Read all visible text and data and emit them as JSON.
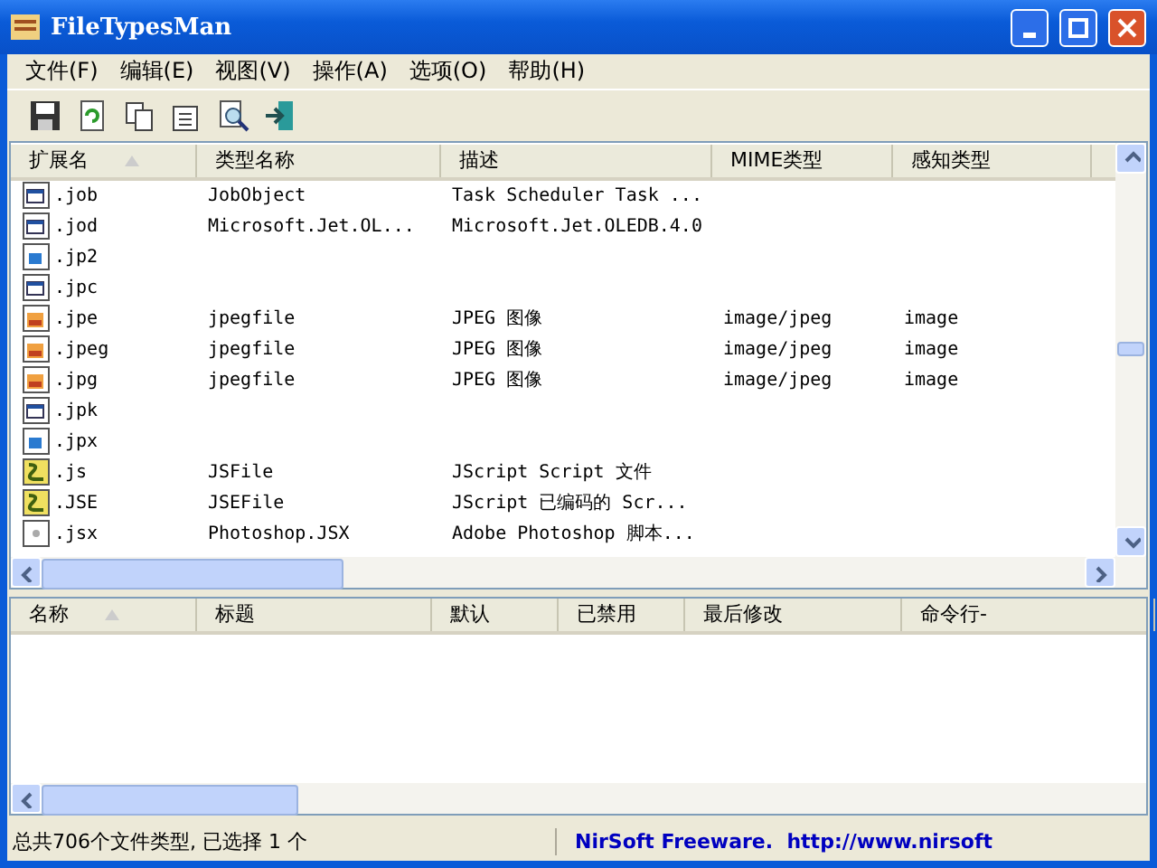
{
  "window": {
    "title": "FileTypesMan"
  },
  "menu": [
    "文件(F)",
    "编辑(E)",
    "视图(V)",
    "操作(A)",
    "选项(O)",
    "帮助(H)"
  ],
  "toolbar": [
    {
      "kind": "save"
    },
    {
      "kind": "refresh"
    },
    {
      "kind": "copy"
    },
    {
      "kind": "properties"
    },
    {
      "kind": "find"
    },
    {
      "kind": "exit"
    }
  ],
  "top_table": {
    "columns": [
      {
        "label": "扩展名",
        "sorted": true
      },
      {
        "label": "类型名称",
        "sorted": false
      },
      {
        "label": "描述",
        "sorted": false
      },
      {
        "label": "MIME类型",
        "sorted": false
      },
      {
        "label": "感知类型",
        "sorted": false
      }
    ],
    "rows": [
      {
        "kind": "window",
        "cells": [
          ".job",
          "JobObject",
          "Task Scheduler Task ...",
          "",
          ""
        ]
      },
      {
        "kind": "window",
        "cells": [
          ".jod",
          "Microsoft.Jet.OL...",
          "Microsoft.Jet.OLEDB.4.0",
          "",
          ""
        ]
      },
      {
        "kind": "image",
        "cells": [
          ".jp2",
          "",
          "",
          "",
          ""
        ]
      },
      {
        "kind": "window",
        "cells": [
          ".jpc",
          "",
          "",
          "",
          ""
        ]
      },
      {
        "kind": "jpeg",
        "cells": [
          ".jpe",
          "jpegfile",
          "JPEG 图像",
          "image/jpeg",
          "image"
        ]
      },
      {
        "kind": "jpeg",
        "cells": [
          ".jpeg",
          "jpegfile",
          "JPEG 图像",
          "image/jpeg",
          "image"
        ]
      },
      {
        "kind": "jpeg",
        "cells": [
          ".jpg",
          "jpegfile",
          "JPEG 图像",
          "image/jpeg",
          "image"
        ]
      },
      {
        "kind": "window",
        "cells": [
          ".jpk",
          "",
          "",
          "",
          ""
        ]
      },
      {
        "kind": "image",
        "cells": [
          ".jpx",
          "",
          "",
          "",
          ""
        ]
      },
      {
        "kind": "script",
        "cells": [
          ".js",
          "JSFile",
          "JScript Script 文件",
          "",
          ""
        ]
      },
      {
        "kind": "script",
        "cells": [
          ".JSE",
          "JSEFile",
          "JScript 已编码的 Scr...",
          "",
          ""
        ]
      },
      {
        "kind": "blank",
        "cells": [
          ".jsx",
          "Photoshop.JSX",
          "Adobe Photoshop 脚本...",
          "",
          ""
        ]
      }
    ]
  },
  "bottom_table": {
    "columns": [
      {
        "label": "名称",
        "sorted": true
      },
      {
        "label": "标题",
        "sorted": false
      },
      {
        "label": "默认",
        "sorted": false
      },
      {
        "label": "已禁用",
        "sorted": false
      },
      {
        "label": "最后修改",
        "sorted": false
      },
      {
        "label": "命令行-",
        "sorted": false
      }
    ]
  },
  "status_bar": {
    "summary": "总共706个文件类型, 已选择 1 个",
    "link": "NirSoft Freeware.  http://www.nirsoft"
  }
}
